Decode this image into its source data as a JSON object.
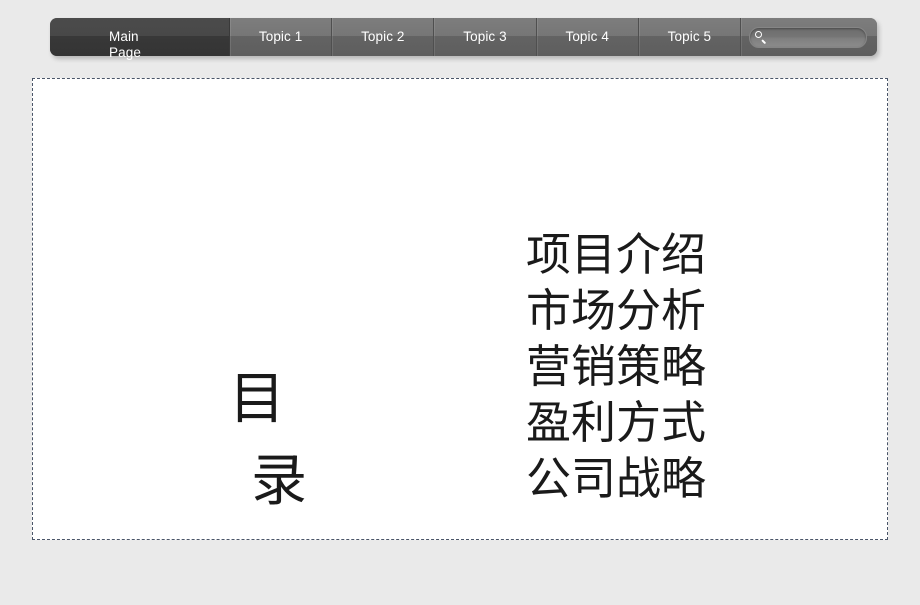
{
  "window": {
    "background_color": "#eaeaea"
  },
  "tabbar": {
    "tabs": [
      {
        "label": "Main Page",
        "active": true
      },
      {
        "label": "Topic 1",
        "active": false
      },
      {
        "label": "Topic 2",
        "active": false
      },
      {
        "label": "Topic 3",
        "active": false
      },
      {
        "label": "Topic 4",
        "active": false
      },
      {
        "label": "Topic 5",
        "active": false
      }
    ],
    "search": {
      "icon": "search-icon",
      "value": "",
      "placeholder": ""
    },
    "active_tab_color": "#3c3c3c",
    "inactive_tab_color": "#6e6e6e"
  },
  "slide": {
    "background_color": "#ffffff",
    "border_color": "#4a5568",
    "title": {
      "line1": "目",
      "line2": "录"
    },
    "items": [
      "项目介绍",
      "市场分析",
      "营销策略",
      "盈利方式",
      "公司战略"
    ]
  }
}
